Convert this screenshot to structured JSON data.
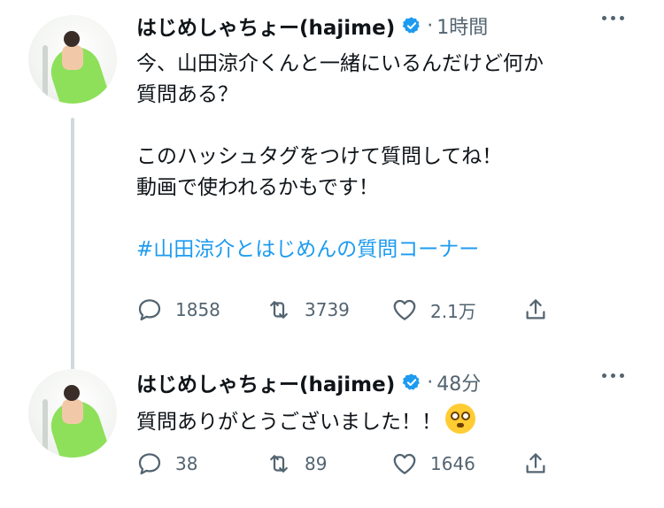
{
  "tweets": [
    {
      "author": "はじめしゃちょー(hajime)",
      "time": "1時間",
      "text_line1": "今、山田涼介くんと一緒にいるんだけど何か",
      "text_line2": "質問ある？",
      "text_line3": "このハッシュタグをつけて質問してね！",
      "text_line4": "動画で使われるかもです！",
      "hashtag": "#山田涼介とはじめんの質問コーナー",
      "replies": "1858",
      "retweets": "3739",
      "likes": "2.1万"
    },
    {
      "author": "はじめしゃちょー(hajime)",
      "time": "48分",
      "text": "質問ありがとうございました！！",
      "emoji": "flushed-face-emoji",
      "replies": "38",
      "retweets": "89",
      "likes": "1646"
    }
  ],
  "colors": {
    "accent": "#1d9bf0",
    "muted": "#536471",
    "text": "#0f1419",
    "thread": "#cfd9de"
  }
}
